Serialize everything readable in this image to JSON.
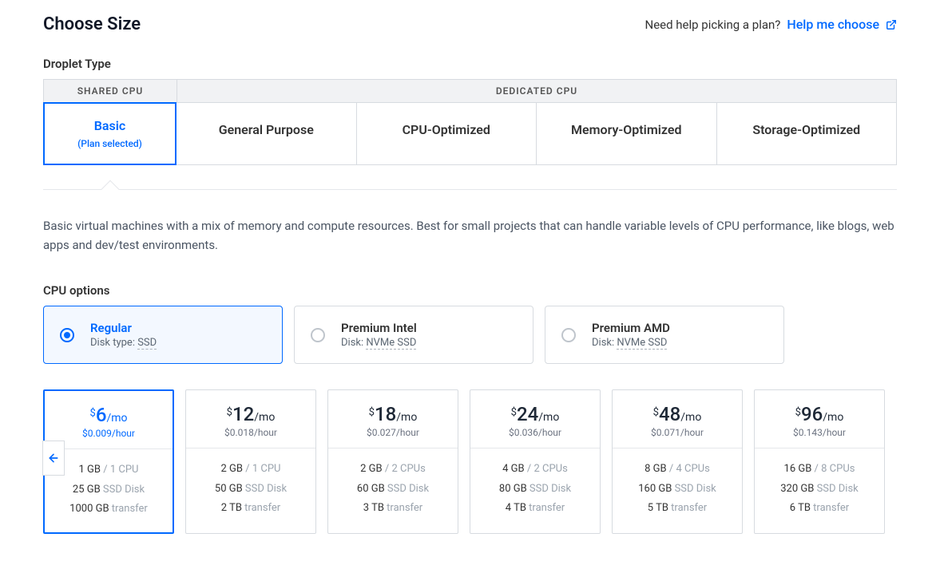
{
  "header": {
    "title": "Choose Size",
    "help_prompt": "Need help picking a plan?",
    "help_link": "Help me choose"
  },
  "droplet_type": {
    "label": "Droplet Type",
    "shared_header": "SHARED CPU",
    "dedicated_header": "DEDICATED CPU",
    "options": [
      {
        "name": "Basic",
        "sub": "(Plan selected)",
        "selected": true
      },
      {
        "name": "General Purpose"
      },
      {
        "name": "CPU-Optimized"
      },
      {
        "name": "Memory-Optimized"
      },
      {
        "name": "Storage-Optimized"
      }
    ]
  },
  "description": "Basic virtual machines with a mix of memory and compute resources. Best for small projects that can handle variable levels of CPU performance, like blogs, web apps and dev/test environments.",
  "cpu_options": {
    "label": "CPU options",
    "items": [
      {
        "name": "Regular",
        "disk_label": "Disk type:",
        "disk_value": "SSD",
        "selected": true
      },
      {
        "name": "Premium Intel",
        "disk_label": "Disk:",
        "disk_value": "NVMe SSD",
        "selected": false
      },
      {
        "name": "Premium AMD",
        "disk_label": "Disk:",
        "disk_value": "NVMe SSD",
        "selected": false
      }
    ]
  },
  "plans": [
    {
      "price_mo": "6",
      "price_hour": "$0.009/hour",
      "ram": "1 GB",
      "cpu": "1 CPU",
      "disk": "25 GB",
      "disk_suffix": "SSD Disk",
      "transfer": "1000 GB",
      "transfer_suffix": "transfer",
      "selected": true
    },
    {
      "price_mo": "12",
      "price_hour": "$0.018/hour",
      "ram": "2 GB",
      "cpu": "1 CPU",
      "disk": "50 GB",
      "disk_suffix": "SSD Disk",
      "transfer": "2 TB",
      "transfer_suffix": "transfer",
      "selected": false
    },
    {
      "price_mo": "18",
      "price_hour": "$0.027/hour",
      "ram": "2 GB",
      "cpu": "2 CPUs",
      "disk": "60 GB",
      "disk_suffix": "SSD Disk",
      "transfer": "3 TB",
      "transfer_suffix": "transfer",
      "selected": false
    },
    {
      "price_mo": "24",
      "price_hour": "$0.036/hour",
      "ram": "4 GB",
      "cpu": "2 CPUs",
      "disk": "80 GB",
      "disk_suffix": "SSD Disk",
      "transfer": "4 TB",
      "transfer_suffix": "transfer",
      "selected": false
    },
    {
      "price_mo": "48",
      "price_hour": "$0.071/hour",
      "ram": "8 GB",
      "cpu": "4 CPUs",
      "disk": "160 GB",
      "disk_suffix": "SSD Disk",
      "transfer": "5 TB",
      "transfer_suffix": "transfer",
      "selected": false
    },
    {
      "price_mo": "96",
      "price_hour": "$0.143/hour",
      "ram": "16 GB",
      "cpu": "8 CPUs",
      "disk": "320 GB",
      "disk_suffix": "SSD Disk",
      "transfer": "6 TB",
      "transfer_suffix": "transfer",
      "selected": false
    }
  ],
  "labels": {
    "per_month": "/mo",
    "currency": "$",
    "spec_sep": " / "
  }
}
